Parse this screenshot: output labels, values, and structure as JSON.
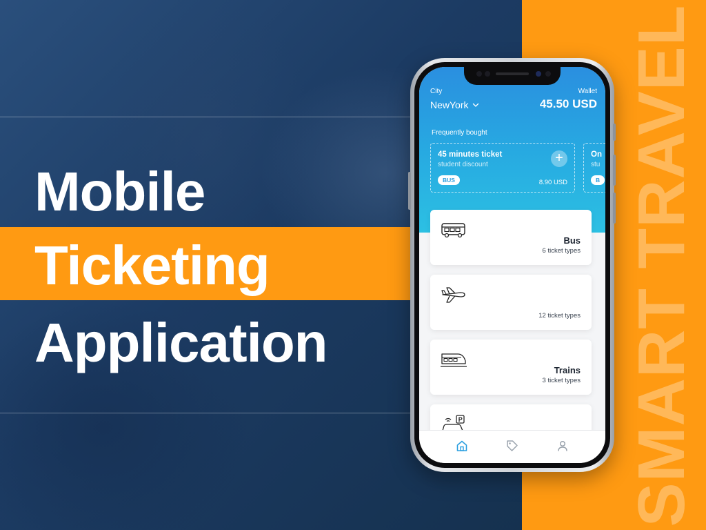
{
  "headline": {
    "line1": "Mobile",
    "line2": "Ticketing",
    "line3": "Application"
  },
  "vertical_word": "SMART TRAVEL",
  "colors": {
    "navy": "#1f3f66",
    "orange": "#ff9a12",
    "app_blue": "#2a9fe0"
  },
  "app": {
    "city": {
      "label": "City",
      "value": "NewYork"
    },
    "wallet": {
      "label": "Wallet",
      "value": "45.50 USD"
    },
    "frequently_bought": {
      "label": "Frequently bought",
      "cards": [
        {
          "title": "45 minutes ticket",
          "subtitle": "student discount",
          "chip": "BUS",
          "price": "8.90 USD"
        },
        {
          "title": "On",
          "subtitle": "stu",
          "chip": "B"
        }
      ]
    },
    "categories": [
      {
        "icon": "bus-icon",
        "title": "Bus",
        "types": "6 ticket types"
      },
      {
        "icon": "plane-icon",
        "title": "",
        "types": "12 ticket types"
      },
      {
        "icon": "train-icon",
        "title": "Trains",
        "types": "3 ticket types"
      },
      {
        "icon": "parking-car-icon",
        "title": "",
        "types": ""
      }
    ],
    "tabbar": [
      "home-icon",
      "ticket-icon",
      "user-icon"
    ]
  }
}
